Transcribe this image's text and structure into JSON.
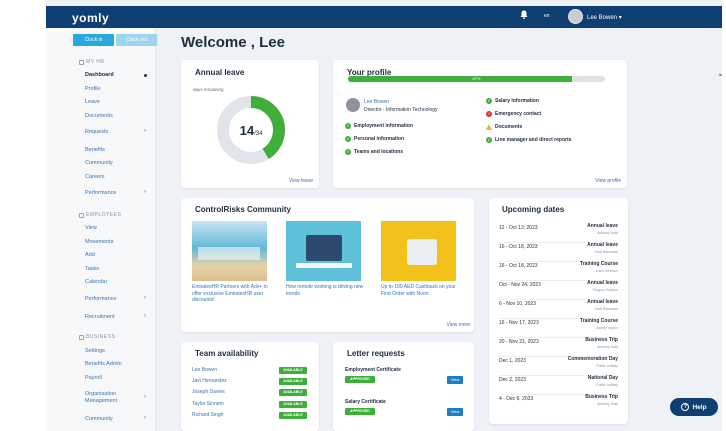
{
  "app": {
    "logo": "yomly",
    "lang": "en",
    "user_name": "Lee Bowen ▾"
  },
  "colors": {
    "brand": "#0f3f72",
    "accent": "#29a8e0",
    "success": "#3fae3a",
    "link": "#3773b4"
  },
  "sidebar": {
    "clock_in": "Clock in",
    "clock_out": "Clock out",
    "sections": [
      {
        "label": "MY HR"
      },
      {
        "label": "EMPLOYEES"
      },
      {
        "label": "BUSINESS"
      }
    ],
    "items": [
      {
        "label": "Dashboard"
      },
      {
        "label": "Profile"
      },
      {
        "label": "Leave"
      },
      {
        "label": "Documents"
      },
      {
        "label": "Requests"
      },
      {
        "label": "Benefits"
      },
      {
        "label": "Community"
      },
      {
        "label": "Careers"
      },
      {
        "label": "Performance"
      },
      {
        "label": "View"
      },
      {
        "label": "Movements"
      },
      {
        "label": "Add"
      },
      {
        "label": "Tasks"
      },
      {
        "label": "Calendar"
      },
      {
        "label": "Performance"
      },
      {
        "label": "Recruitment"
      },
      {
        "label": "Settings"
      },
      {
        "label": "Benefits Admin"
      },
      {
        "label": "Payroll"
      },
      {
        "label": "Organisation Management"
      },
      {
        "label": "Community"
      }
    ]
  },
  "main": {
    "title": "Welcome , Lee"
  },
  "annual_leave": {
    "title": "Annual leave",
    "subtitle": "days remaining",
    "remaining": 14,
    "total": "/34",
    "link": "View leave"
  },
  "profile": {
    "title": "Your profile",
    "progress_label": "87%",
    "progress": 0.87,
    "name": "Lee Bowen",
    "role": "Director - Information Technology",
    "left_items": [
      {
        "label": "Employment information",
        "status": "ok"
      },
      {
        "label": "Personal information",
        "status": "ok"
      },
      {
        "label": "Teams and locations",
        "status": "ok"
      }
    ],
    "right_items": [
      {
        "label": "Salary information",
        "status": "ok"
      },
      {
        "label": "Emergency contact",
        "status": "error"
      },
      {
        "label": "Documents",
        "status": "warning"
      },
      {
        "label": "Line manager and direct reports",
        "status": "ok"
      }
    ],
    "link": "View profile"
  },
  "community": {
    "title": "ControlRisks Community",
    "posts": [
      {
        "text": "EmiratesHR Partners with Adv+ to offer exclusive EmiratesHR user discounts!"
      },
      {
        "text": "How remote working is driving new trends"
      },
      {
        "text": "Up to 100 AED Cashback on your First Order with Noon"
      }
    ],
    "link": "View more"
  },
  "upcoming": {
    "title": "Upcoming dates",
    "rows": [
      {
        "date": "12 - Oct 13, 2023",
        "title": "Annual leave",
        "sub": "Anthony Hatti"
      },
      {
        "date": "16 - Oct 18, 2023",
        "title": "Annual leave",
        "sub": "Hadi Ramadan"
      },
      {
        "date": "16 - Oct 18, 2023",
        "title": "Training Course",
        "sub": "Liam Johnson"
      },
      {
        "date": "Oct - Nov 24, 2023",
        "title": "Annual leave",
        "sub": "Gregory Hudson"
      },
      {
        "date": "6 - Nov 10, 2023",
        "title": "Annual leave",
        "sub": "Hadi Ramadan"
      },
      {
        "date": "16 - Nov 17, 2023",
        "title": "Training Course",
        "sub": "Ashley Yachin"
      },
      {
        "date": "20 - Nov 21, 2023",
        "title": "Business Trip",
        "sub": "Anthony Hatti"
      },
      {
        "date": "Dec 1, 2023",
        "title": "Commemoration Day",
        "sub": "Public holiday"
      },
      {
        "date": "Dec 2, 2023",
        "title": "National Day",
        "sub": "Public holiday"
      },
      {
        "date": "4 - Dec 6, 2023",
        "title": "Business Trip",
        "sub": "Anthony Hatti"
      }
    ]
  },
  "team": {
    "title": "Team availability",
    "rows": [
      {
        "name": "Lee Bowen",
        "status": "AVAILABLE"
      },
      {
        "name": "Javi Hernandez",
        "status": "AVAILABLE"
      },
      {
        "name": "Joseph Davies",
        "status": "AVAILABLE"
      },
      {
        "name": "Taylor Sionem",
        "status": "AVAILABLE"
      },
      {
        "name": "Richard Singh",
        "status": "AVAILABLE"
      }
    ]
  },
  "letters": {
    "title": "Letter requests",
    "rows": [
      {
        "name": "Employment Certificate",
        "status": "APPROVED",
        "action": "View"
      },
      {
        "name": "Salary Certificate",
        "status": "APPROVED",
        "action": "View"
      }
    ]
  },
  "help": {
    "label": "Help"
  },
  "edge_text": "le"
}
